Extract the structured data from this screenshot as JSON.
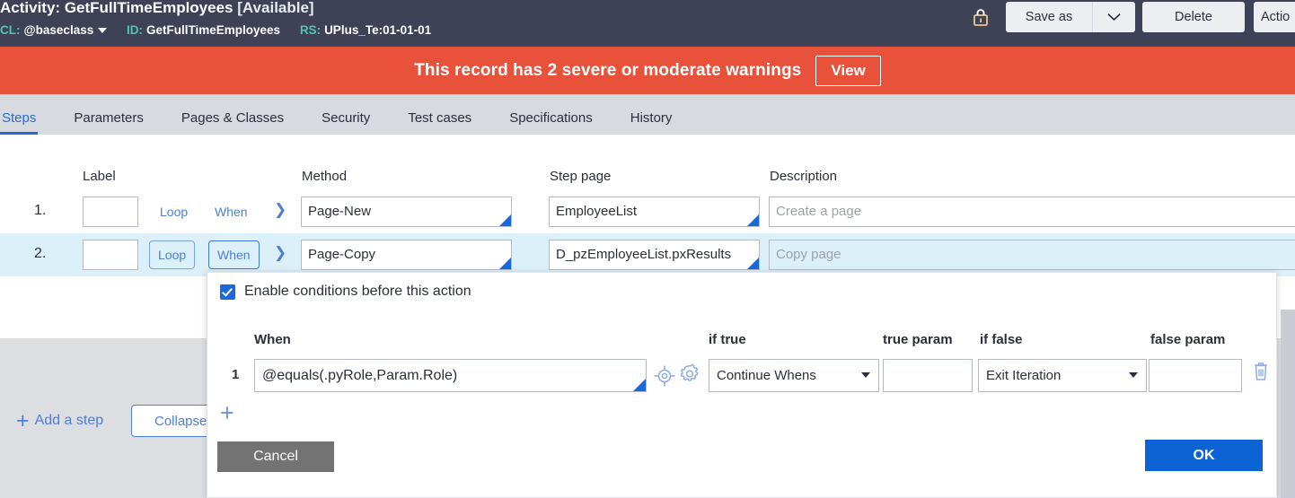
{
  "header": {
    "title_prefix": "Activity:",
    "title_name": "GetFullTimeEmployees",
    "title_status": "[Available]",
    "class_label": "CL:",
    "class_value": "@baseclass",
    "id_label": "ID:",
    "id_value": "GetFullTimeEmployees",
    "ruleset_label": "RS:",
    "ruleset_value": "UPlus_Te:01-01-01",
    "lock_icon": "lock-icon",
    "buttons": {
      "save_as": "Save as",
      "save_as_dropdown_icon": "chevron-down-icon",
      "delete": "Delete",
      "actions": "Actio"
    },
    "bg_color": "#3f4257",
    "accent_color": "#4ec4b0"
  },
  "banner": {
    "message": "This record has 2 severe or moderate warnings",
    "view_label": "View",
    "color": "#e8513a"
  },
  "tabs": {
    "active_index": 0,
    "items": [
      {
        "label": "Steps"
      },
      {
        "label": "Parameters"
      },
      {
        "label": "Pages & Classes"
      },
      {
        "label": "Security"
      },
      {
        "label": "Test cases"
      },
      {
        "label": "Specifications"
      },
      {
        "label": "History"
      }
    ],
    "active_color": "#2b6ad0"
  },
  "steps": {
    "columns": {
      "label": "Label",
      "method": "Method",
      "step_page": "Step page",
      "description": "Description"
    },
    "rows": [
      {
        "num": "1.",
        "label_value": "",
        "loop": "Loop",
        "when": "When",
        "expand_icon": "chevron-right-icon",
        "method": "Page-New",
        "step_page": "EmployeeList",
        "description_placeholder": "Create a page"
      },
      {
        "num": "2.",
        "label_value": "",
        "loop": "Loop",
        "when": "When",
        "expand_icon": "chevron-right-icon",
        "method": "Page-Copy",
        "step_page": "D_pzEmployeeList.pxResults",
        "description_placeholder": "Copy page"
      }
    ],
    "add_step_label": "Add a step",
    "add_step_icon": "plus-icon",
    "collapse_label": "Collapse"
  },
  "modal": {
    "enable_checkbox_label": "Enable conditions before this action",
    "enable_checked": true,
    "columns": {
      "when": "When",
      "if_true": "if true",
      "true_param": "true param",
      "if_false": "if false",
      "false_param": "false param"
    },
    "conditions": [
      {
        "num": "1",
        "when_value": "@equals(.pyRole,Param.Role)",
        "target_icon": "crosshair-icon",
        "gear_icon": "gear-icon",
        "if_true_value": "Continue Whens",
        "true_param_value": "",
        "if_false_value": "Exit Iteration",
        "false_param_value": "",
        "delete_icon": "trash-icon"
      }
    ],
    "add_condition_icon": "plus-icon",
    "cancel_label": "Cancel",
    "ok_label": "OK",
    "ok_color": "#0b63d6",
    "cancel_color": "#737373"
  }
}
